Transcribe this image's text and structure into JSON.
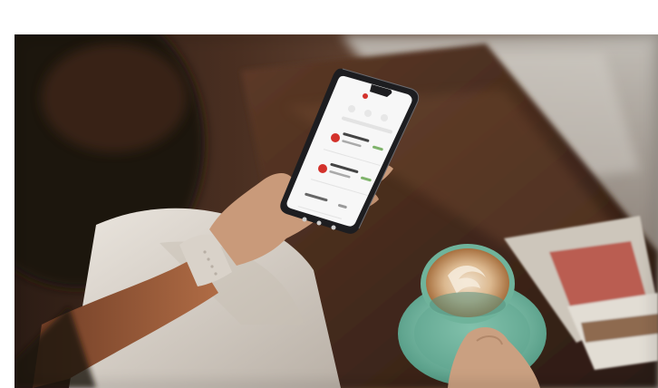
{
  "image": {
    "subject": "person-holding-phone-with-coffee",
    "palette": {
      "background": "#ffffff",
      "wood_dark": "#2a1a12",
      "wood_mid": "#5a3826",
      "window_light": "#b8b4ad",
      "phone_body": "#1d1d20",
      "screen": "#f7f7f7",
      "accent_red": "#d3312b",
      "sleeve": "#9a5a38",
      "pants": "#ddd6cc",
      "skin": "#caa081",
      "watch_band": "#d9d2c9",
      "saucer": "#7fbfa8",
      "latte": "#d8b78f",
      "book_red": "#b33a2e"
    }
  }
}
